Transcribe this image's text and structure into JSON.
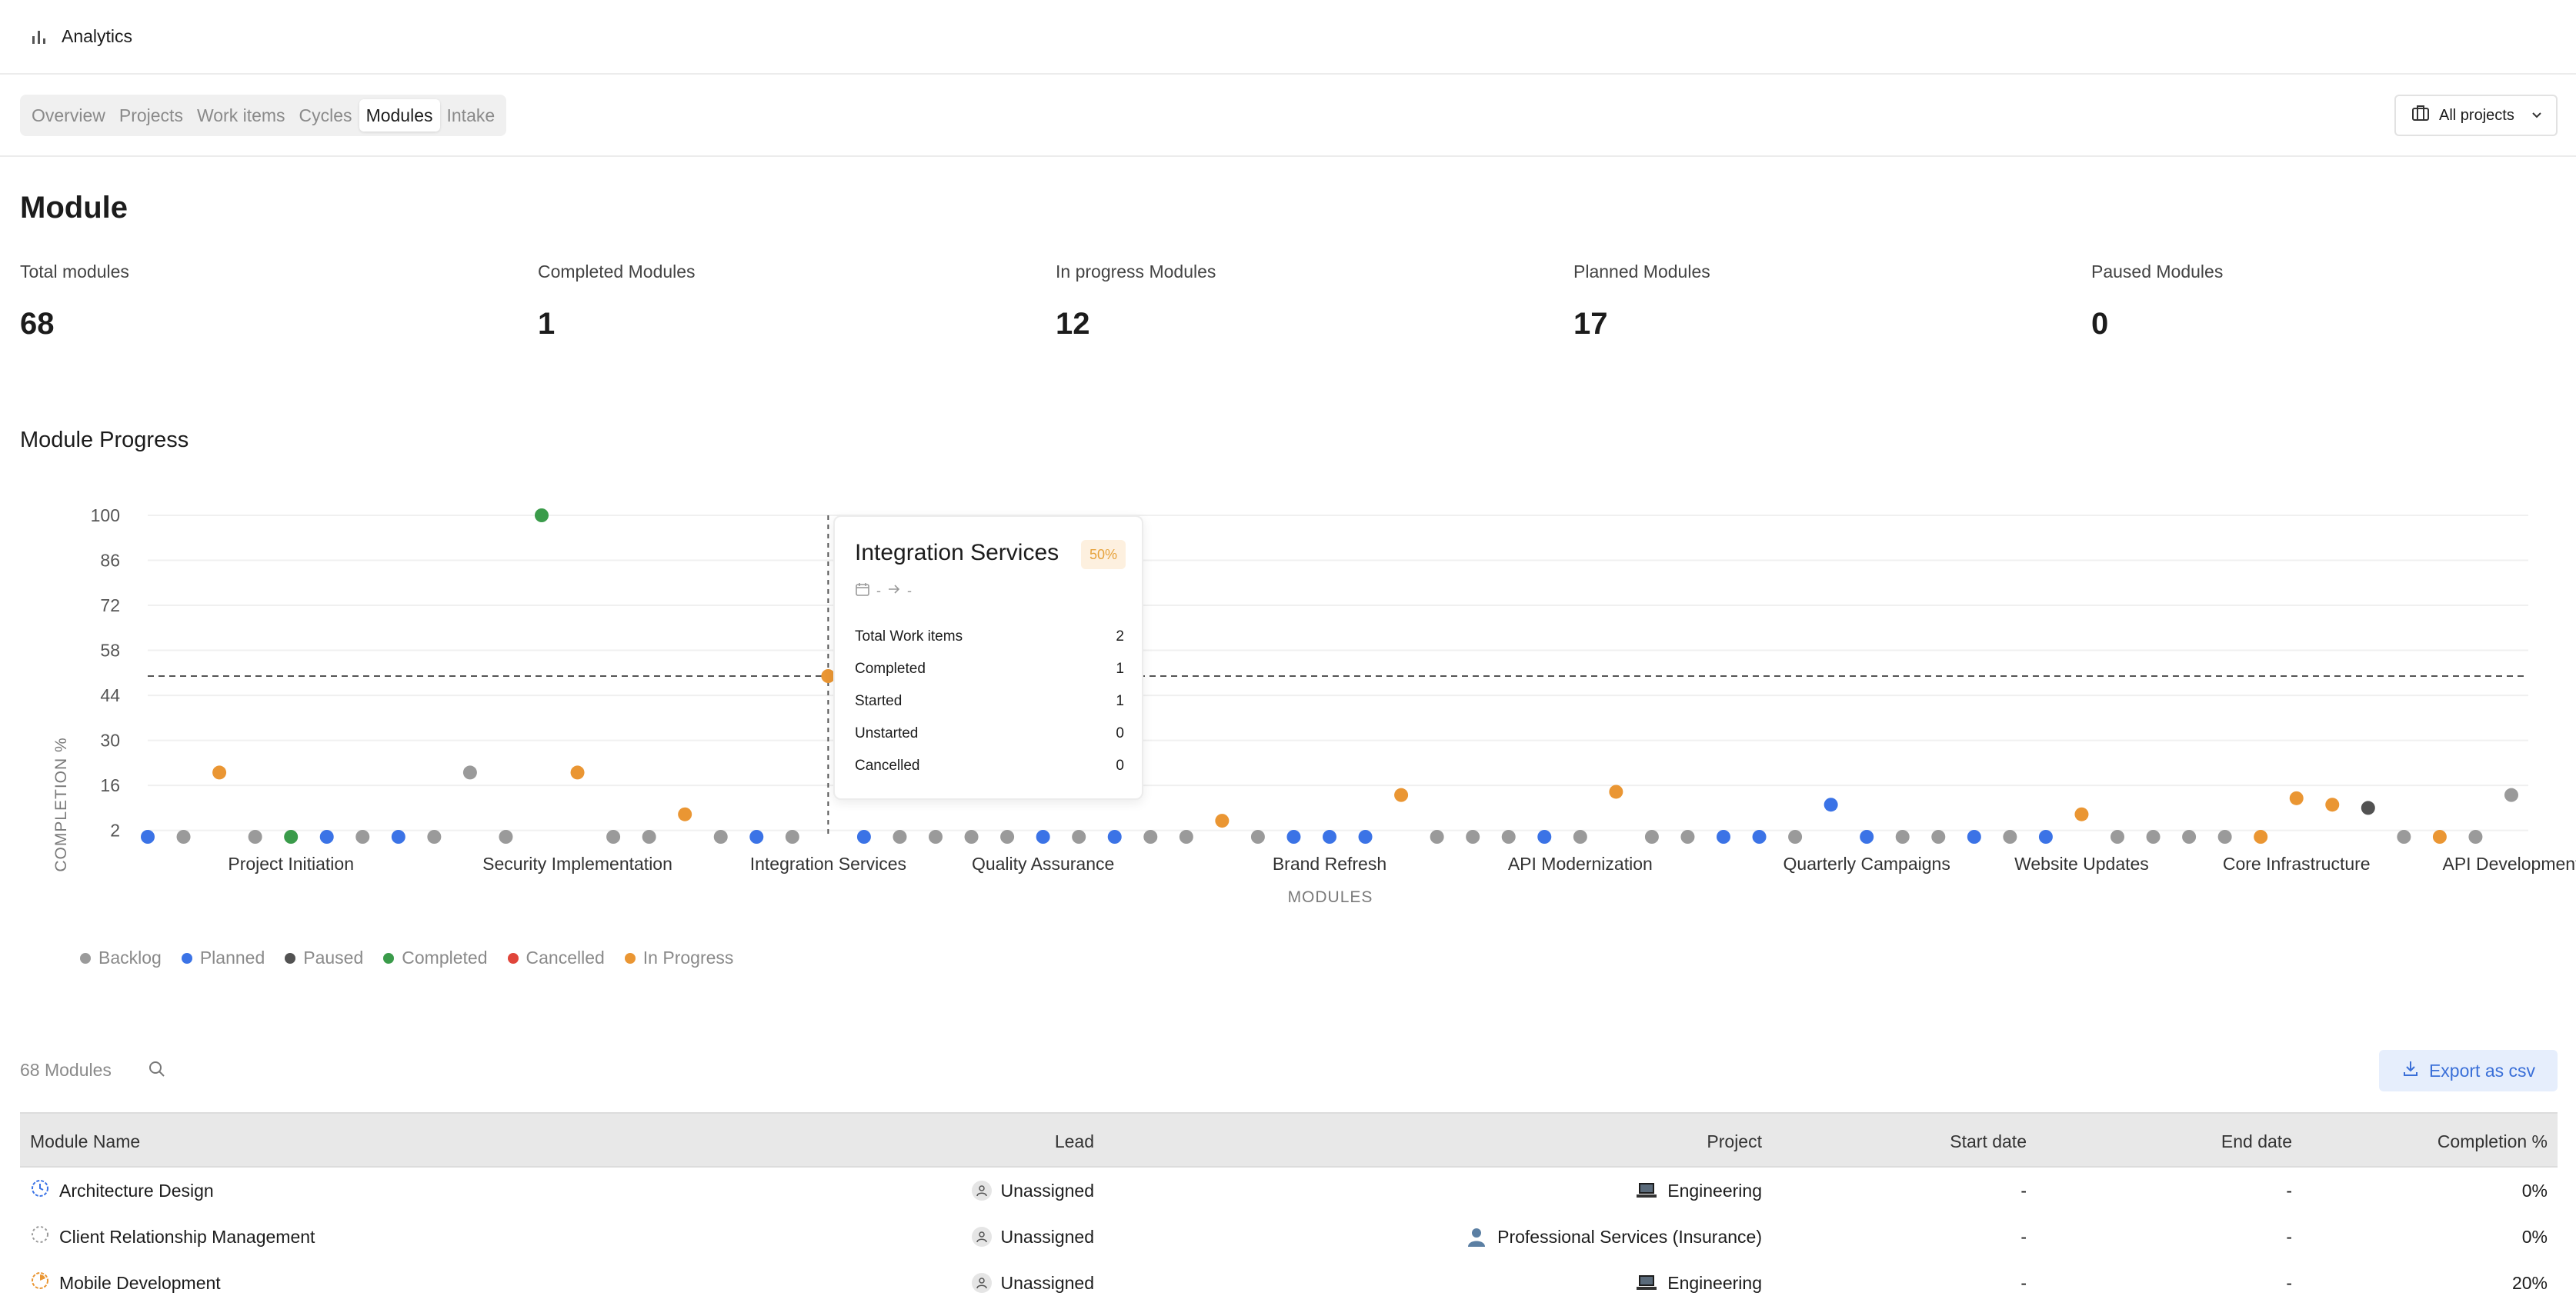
{
  "header": {
    "title": "Analytics",
    "icon": "bar-chart-icon"
  },
  "tabs": [
    {
      "label": "Overview",
      "active": false
    },
    {
      "label": "Projects",
      "active": false
    },
    {
      "label": "Work items",
      "active": false
    },
    {
      "label": "Cycles",
      "active": false
    },
    {
      "label": "Modules",
      "active": true
    },
    {
      "label": "Intake",
      "active": false
    }
  ],
  "project_filter": {
    "label": "All projects",
    "icon": "briefcase-icon"
  },
  "module_section": {
    "title": "Module",
    "stats": [
      {
        "label": "Total modules",
        "value": "68"
      },
      {
        "label": "Completed Modules",
        "value": "1"
      },
      {
        "label": "In progress Modules",
        "value": "12"
      },
      {
        "label": "Planned Modules",
        "value": "17"
      },
      {
        "label": "Paused Modules",
        "value": "0"
      }
    ]
  },
  "progress": {
    "title": "Module Progress"
  },
  "colors": {
    "Backlog": "#9a9a9a",
    "Planned": "#3b73e6",
    "Paused": "#525252",
    "Completed": "#3a9b4a",
    "Cancelled": "#e0453a",
    "In Progress": "#ea9633"
  },
  "chart_data": {
    "type": "scatter",
    "xlabel": "MODULES",
    "ylabel": "COMPLETION %",
    "ylim": [
      0,
      100
    ],
    "yticks": [
      2,
      16,
      30,
      44,
      58,
      72,
      86,
      100
    ],
    "average_line": 50,
    "x_tick_labels": [
      {
        "index": 4,
        "label": "Project Initiation"
      },
      {
        "index": 12,
        "label": "Security Implementation"
      },
      {
        "index": 19,
        "label": "Integration Services"
      },
      {
        "index": 25,
        "label": "Quality Assurance"
      },
      {
        "index": 33,
        "label": "Brand Refresh"
      },
      {
        "index": 40,
        "label": "API Modernization"
      },
      {
        "index": 48,
        "label": "Quarterly Campaigns"
      },
      {
        "index": 54,
        "label": "Website Updates"
      },
      {
        "index": 60,
        "label": "Core Infrastructure"
      },
      {
        "index": 66,
        "label": "API Development"
      }
    ],
    "points": [
      {
        "s": "Planned",
        "y": 0
      },
      {
        "s": "Backlog",
        "y": 0
      },
      {
        "s": "In Progress",
        "y": 20
      },
      {
        "s": "Backlog",
        "y": 0
      },
      {
        "s": "Completed",
        "y": 0
      },
      {
        "s": "Planned",
        "y": 0
      },
      {
        "s": "Backlog",
        "y": 0
      },
      {
        "s": "Planned",
        "y": 0
      },
      {
        "s": "Backlog",
        "y": 0
      },
      {
        "s": "Backlog",
        "y": 20
      },
      {
        "s": "Backlog",
        "y": 0
      },
      {
        "s": "Completed",
        "y": 100
      },
      {
        "s": "In Progress",
        "y": 20
      },
      {
        "s": "Backlog",
        "y": 0
      },
      {
        "s": "Backlog",
        "y": 0
      },
      {
        "s": "In Progress",
        "y": 7
      },
      {
        "s": "Backlog",
        "y": 0
      },
      {
        "s": "Planned",
        "y": 0
      },
      {
        "s": "Backlog",
        "y": 0
      },
      {
        "s": "In Progress",
        "y": 50
      },
      {
        "s": "Planned",
        "y": 0
      },
      {
        "s": "Backlog",
        "y": 0
      },
      {
        "s": "Backlog",
        "y": 0
      },
      {
        "s": "Backlog",
        "y": 0
      },
      {
        "s": "Backlog",
        "y": 0
      },
      {
        "s": "Planned",
        "y": 0
      },
      {
        "s": "Backlog",
        "y": 0
      },
      {
        "s": "Planned",
        "y": 0
      },
      {
        "s": "Backlog",
        "y": 0
      },
      {
        "s": "Backlog",
        "y": 0
      },
      {
        "s": "In Progress",
        "y": 5
      },
      {
        "s": "Backlog",
        "y": 0
      },
      {
        "s": "Planned",
        "y": 0
      },
      {
        "s": "Planned",
        "y": 0
      },
      {
        "s": "Planned",
        "y": 0
      },
      {
        "s": "In Progress",
        "y": 13
      },
      {
        "s": "Backlog",
        "y": 0
      },
      {
        "s": "Backlog",
        "y": 0
      },
      {
        "s": "Backlog",
        "y": 0
      },
      {
        "s": "Planned",
        "y": 0
      },
      {
        "s": "Backlog",
        "y": 0
      },
      {
        "s": "In Progress",
        "y": 14
      },
      {
        "s": "Backlog",
        "y": 0
      },
      {
        "s": "Backlog",
        "y": 0
      },
      {
        "s": "Planned",
        "y": 0
      },
      {
        "s": "Planned",
        "y": 0
      },
      {
        "s": "Backlog",
        "y": 0
      },
      {
        "s": "Planned",
        "y": 10
      },
      {
        "s": "Planned",
        "y": 0
      },
      {
        "s": "Backlog",
        "y": 0
      },
      {
        "s": "Backlog",
        "y": 0
      },
      {
        "s": "Planned",
        "y": 0
      },
      {
        "s": "Backlog",
        "y": 0
      },
      {
        "s": "Planned",
        "y": 0
      },
      {
        "s": "In Progress",
        "y": 7
      },
      {
        "s": "Backlog",
        "y": 0
      },
      {
        "s": "Backlog",
        "y": 0
      },
      {
        "s": "Backlog",
        "y": 0
      },
      {
        "s": "Backlog",
        "y": 0
      },
      {
        "s": "In Progress",
        "y": 0
      },
      {
        "s": "In Progress",
        "y": 12
      },
      {
        "s": "In Progress",
        "y": 10
      },
      {
        "s": "Paused",
        "y": 9
      },
      {
        "s": "Backlog",
        "y": 0
      },
      {
        "s": "In Progress",
        "y": 0
      },
      {
        "s": "Backlog",
        "y": 0
      },
      {
        "s": "Backlog",
        "y": 13
      }
    ]
  },
  "tooltip": {
    "title": "Integration Services",
    "badge": "50%",
    "start": "-",
    "end": "-",
    "rows": [
      {
        "label": "Total Work items",
        "value": "2"
      },
      {
        "label": "Completed",
        "value": "1"
      },
      {
        "label": "Started",
        "value": "1"
      },
      {
        "label": "Unstarted",
        "value": "0"
      },
      {
        "label": "Cancelled",
        "value": "0"
      }
    ]
  },
  "legend": [
    "Backlog",
    "Planned",
    "Paused",
    "Completed",
    "Cancelled",
    "In Progress"
  ],
  "table": {
    "count_label": "68 Modules",
    "export_label": "Export as csv",
    "columns": [
      "Module Name",
      "Lead",
      "Project",
      "Start date",
      "End date",
      "Completion %"
    ],
    "rows": [
      {
        "name": "Architecture Design",
        "status_icon": "planned-status-icon",
        "lead": "Unassigned",
        "project": "Engineering",
        "project_icon": "laptop-icon",
        "start": "-",
        "end": "-",
        "completion": "0%"
      },
      {
        "name": "Client Relationship Management",
        "status_icon": "backlog-status-icon",
        "lead": "Unassigned",
        "project": "Professional Services (Insurance)",
        "project_icon": "person-icon",
        "start": "-",
        "end": "-",
        "completion": "0%"
      },
      {
        "name": "Mobile Development",
        "status_icon": "in-progress-status-icon",
        "lead": "Unassigned",
        "project": "Engineering",
        "project_icon": "laptop-icon",
        "start": "-",
        "end": "-",
        "completion": "20%"
      }
    ]
  }
}
